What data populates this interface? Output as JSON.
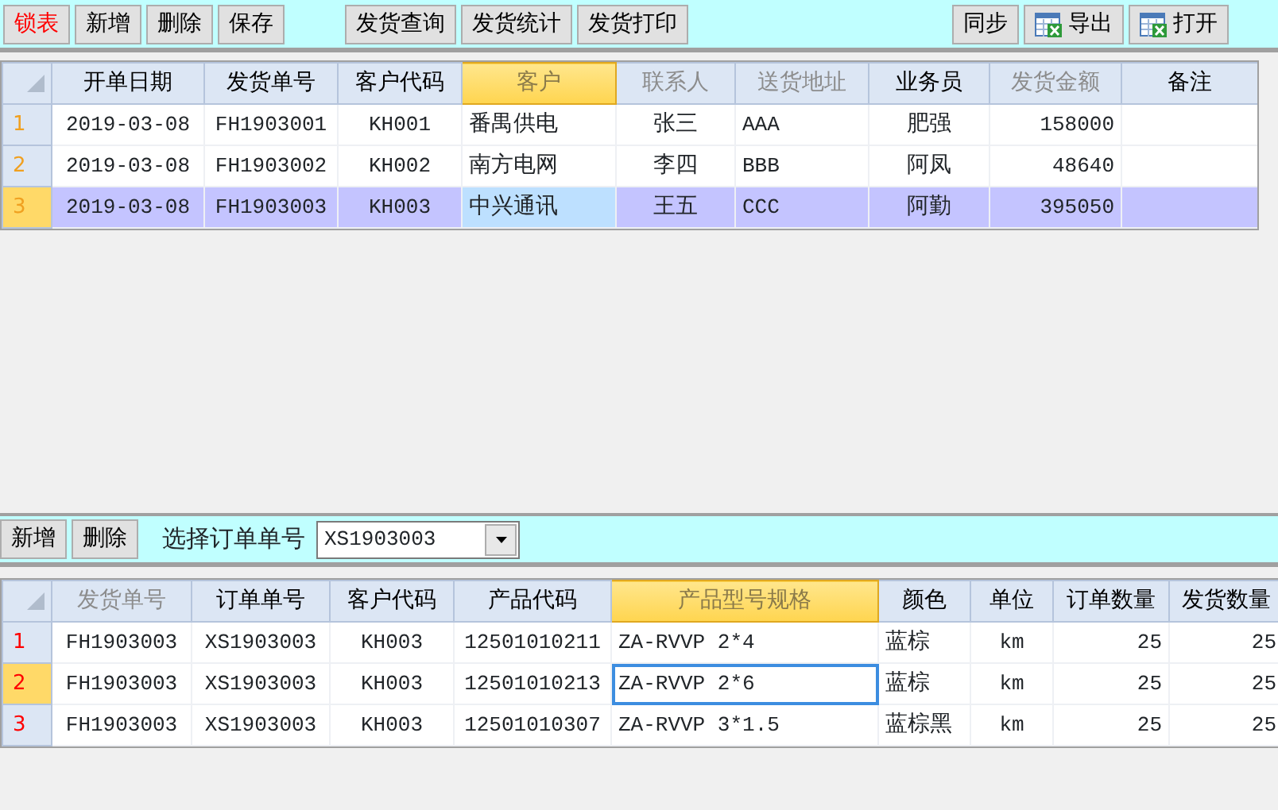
{
  "toolbar": {
    "groups": [
      {
        "buttons": [
          {
            "label": "锁表",
            "alert": true
          },
          {
            "label": "新增",
            "alert": false
          },
          {
            "label": "删除",
            "alert": false
          },
          {
            "label": "保存",
            "alert": false
          }
        ]
      },
      {
        "buttons": [
          {
            "label": "发货查询",
            "alert": false
          },
          {
            "label": "发货统计",
            "alert": false
          },
          {
            "label": "发货打印",
            "alert": false
          }
        ]
      },
      {
        "buttons": [
          {
            "label": "同步",
            "alert": false,
            "kind": "text"
          },
          {
            "label": "导出",
            "alert": false,
            "kind": "icon"
          },
          {
            "label": "打开",
            "alert": false,
            "kind": "icon"
          }
        ]
      }
    ]
  },
  "orders_grid": {
    "columns": [
      {
        "label": "开单日期",
        "current": false,
        "dimmed": false
      },
      {
        "label": "发货单号",
        "current": false,
        "dimmed": false
      },
      {
        "label": "客户代码",
        "current": false,
        "dimmed": false
      },
      {
        "label": "客户",
        "current": true,
        "dimmed": false
      },
      {
        "label": "联系人",
        "current": false,
        "dimmed": true
      },
      {
        "label": "送货地址",
        "current": false,
        "dimmed": true
      },
      {
        "label": "业务员",
        "current": false,
        "dimmed": false
      },
      {
        "label": "发货金额",
        "current": false,
        "dimmed": true
      },
      {
        "label": "备注",
        "current": false,
        "dimmed": false
      }
    ],
    "rows": [
      {
        "number": "1",
        "current": false,
        "selected": false,
        "cells": [
          "2019-03-08",
          "FH1903001",
          "KH001",
          "番禺供电",
          "张三",
          "AAA",
          "肥强",
          "158000",
          ""
        ]
      },
      {
        "number": "2",
        "current": false,
        "selected": false,
        "cells": [
          "2019-03-08",
          "FH1903002",
          "KH002",
          "南方电网",
          "李四",
          "BBB",
          "阿凤",
          "48640",
          ""
        ]
      },
      {
        "number": "3",
        "current": true,
        "selected": true,
        "cells": [
          "2019-03-08",
          "FH1903003",
          "KH003",
          "中兴通讯",
          "王五",
          "CCC",
          "阿勤",
          "395050",
          ""
        ]
      }
    ]
  },
  "detail_toolbar": {
    "buttons": [
      {
        "label": "新增"
      },
      {
        "label": "删除"
      }
    ],
    "order_select": {
      "label": "选择订单单号",
      "value": "XS1903003"
    }
  },
  "items_grid": {
    "columns": [
      {
        "label": "发货单号",
        "current": false,
        "dimmed": true
      },
      {
        "label": "订单单号",
        "current": false,
        "dimmed": false
      },
      {
        "label": "客户代码",
        "current": false,
        "dimmed": false
      },
      {
        "label": "产品代码",
        "current": false,
        "dimmed": false
      },
      {
        "label": "产品型号规格",
        "current": true,
        "dimmed": false
      },
      {
        "label": "颜色",
        "current": false,
        "dimmed": false
      },
      {
        "label": "单位",
        "current": false,
        "dimmed": false
      },
      {
        "label": "订单数量",
        "current": false,
        "dimmed": false
      },
      {
        "label": "发货数量",
        "current": false,
        "dimmed": false
      }
    ],
    "rows": [
      {
        "number": "1",
        "current": false,
        "selected": false,
        "cells": [
          "FH1903003",
          "XS1903003",
          "KH003",
          "12501010211",
          "ZA-RVVP 2*4",
          "蓝棕",
          "km",
          "25",
          "25"
        ]
      },
      {
        "number": "2",
        "current": true,
        "selected": false,
        "cells": [
          "FH1903003",
          "XS1903003",
          "KH003",
          "12501010213",
          "ZA-RVVP 2*6",
          "蓝棕",
          "km",
          "25",
          "25"
        ]
      },
      {
        "number": "3",
        "current": false,
        "selected": false,
        "cells": [
          "FH1903003",
          "XS1903003",
          "KH003",
          "12501010307",
          "ZA-RVVP 3*1.5",
          "蓝棕黑",
          "km",
          "25",
          "25"
        ]
      }
    ]
  }
}
